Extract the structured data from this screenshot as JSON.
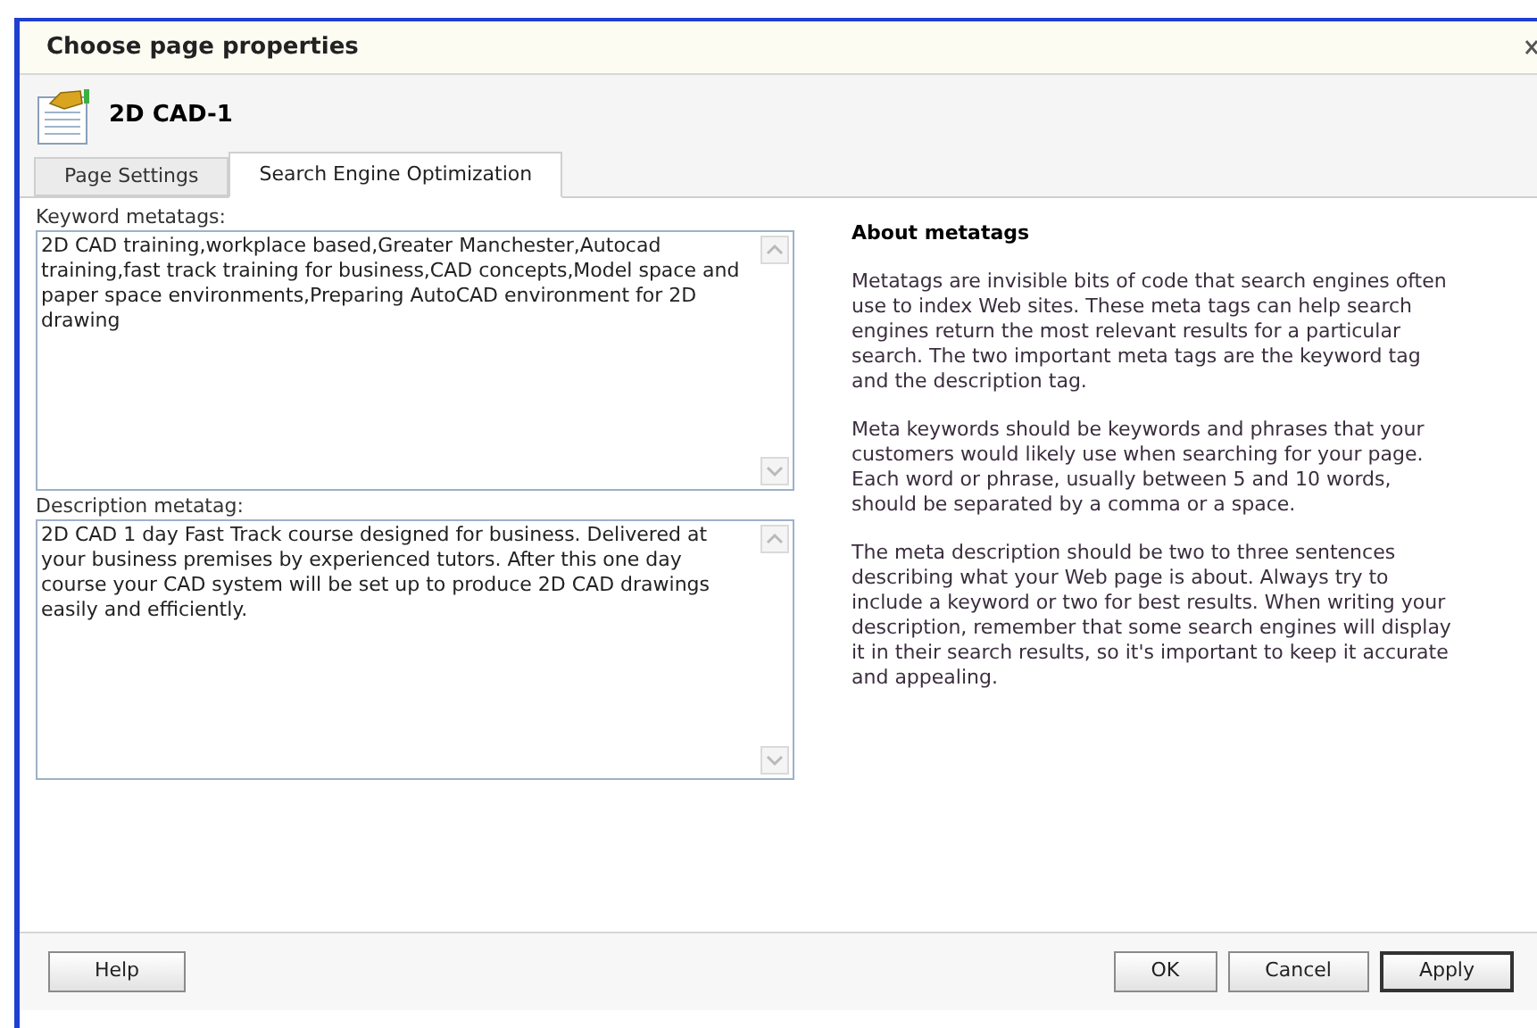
{
  "window": {
    "title": "Choose page properties"
  },
  "page": {
    "name": "2D CAD-1"
  },
  "tabs": [
    {
      "label": "Page Settings",
      "selected": false
    },
    {
      "label": "Search Engine Optimization",
      "selected": true
    }
  ],
  "fields": [
    {
      "label": "Keyword metatags:",
      "value": "2D CAD training,workplace based,Greater Manchester,Autocad training,fast track training for business,CAD concepts,Model space and paper space environments,Preparing AutoCAD environment for 2D drawing"
    },
    {
      "label": "Description metatag:",
      "value": "2D CAD 1 day Fast Track course designed for business. Delivered at your business premises by experienced tutors. After this one day course your CAD system will be set up to produce 2D CAD drawings easily and efficiently."
    }
  ],
  "help_panel": {
    "heading": "About metatags",
    "paragraphs": [
      "Metatags are invisible bits of code that search engines often use to index Web sites. These meta tags can help search engines return the most relevant results for a particular search. The two important meta tags are the keyword tag and the description tag.",
      "Meta keywords should be keywords and phrases that your customers would likely use when searching for your page. Each word or phrase, usually between 5 and 10 words, should be separated by a comma or a space.",
      "The meta description should be two to three sentences describing what your Web page is about. Always try to include a keyword or two for best results. When writing your description, remember that some search engines will display it in their search results, so it's important to keep it accurate and appealing."
    ]
  },
  "buttons": [
    {
      "label": "Help",
      "kind": "help",
      "default": false
    },
    {
      "label": "OK",
      "kind": "action",
      "default": false
    },
    {
      "label": "Cancel",
      "kind": "action",
      "default": false
    },
    {
      "label": "Apply",
      "kind": "action",
      "default": true
    }
  ]
}
